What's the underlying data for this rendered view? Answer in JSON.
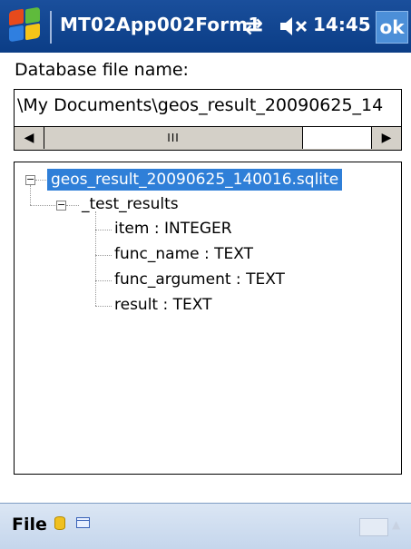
{
  "titlebar": {
    "app_title": "MT02App002Form1",
    "time": "14:45",
    "ok_label": "ok",
    "icons": [
      "windows-start-icon",
      "connectivity-icon",
      "volume-muted-icon"
    ]
  },
  "form": {
    "db_label": "Database file name:",
    "db_path_value": "\\My Documents\\geos_result_20090625_14"
  },
  "scrollbar": {
    "thumb_grip": "III",
    "left_arrow": "◀",
    "right_arrow": "▶"
  },
  "tree": {
    "root": "geos_result_20090625_140016.sqlite",
    "table": "_test_results",
    "columns": [
      {
        "name": "item",
        "type": "INTEGER"
      },
      {
        "name": "func_name",
        "type": "TEXT"
      },
      {
        "name": "func_argument",
        "type": "TEXT"
      },
      {
        "name": "result",
        "type": "TEXT"
      }
    ],
    "collapse_symbol": "−"
  },
  "menubar": {
    "file_label": "File"
  },
  "colors": {
    "titlebar": "#0b3d86",
    "selection": "#2f7fd8",
    "menubar": "#c5d6ec"
  }
}
